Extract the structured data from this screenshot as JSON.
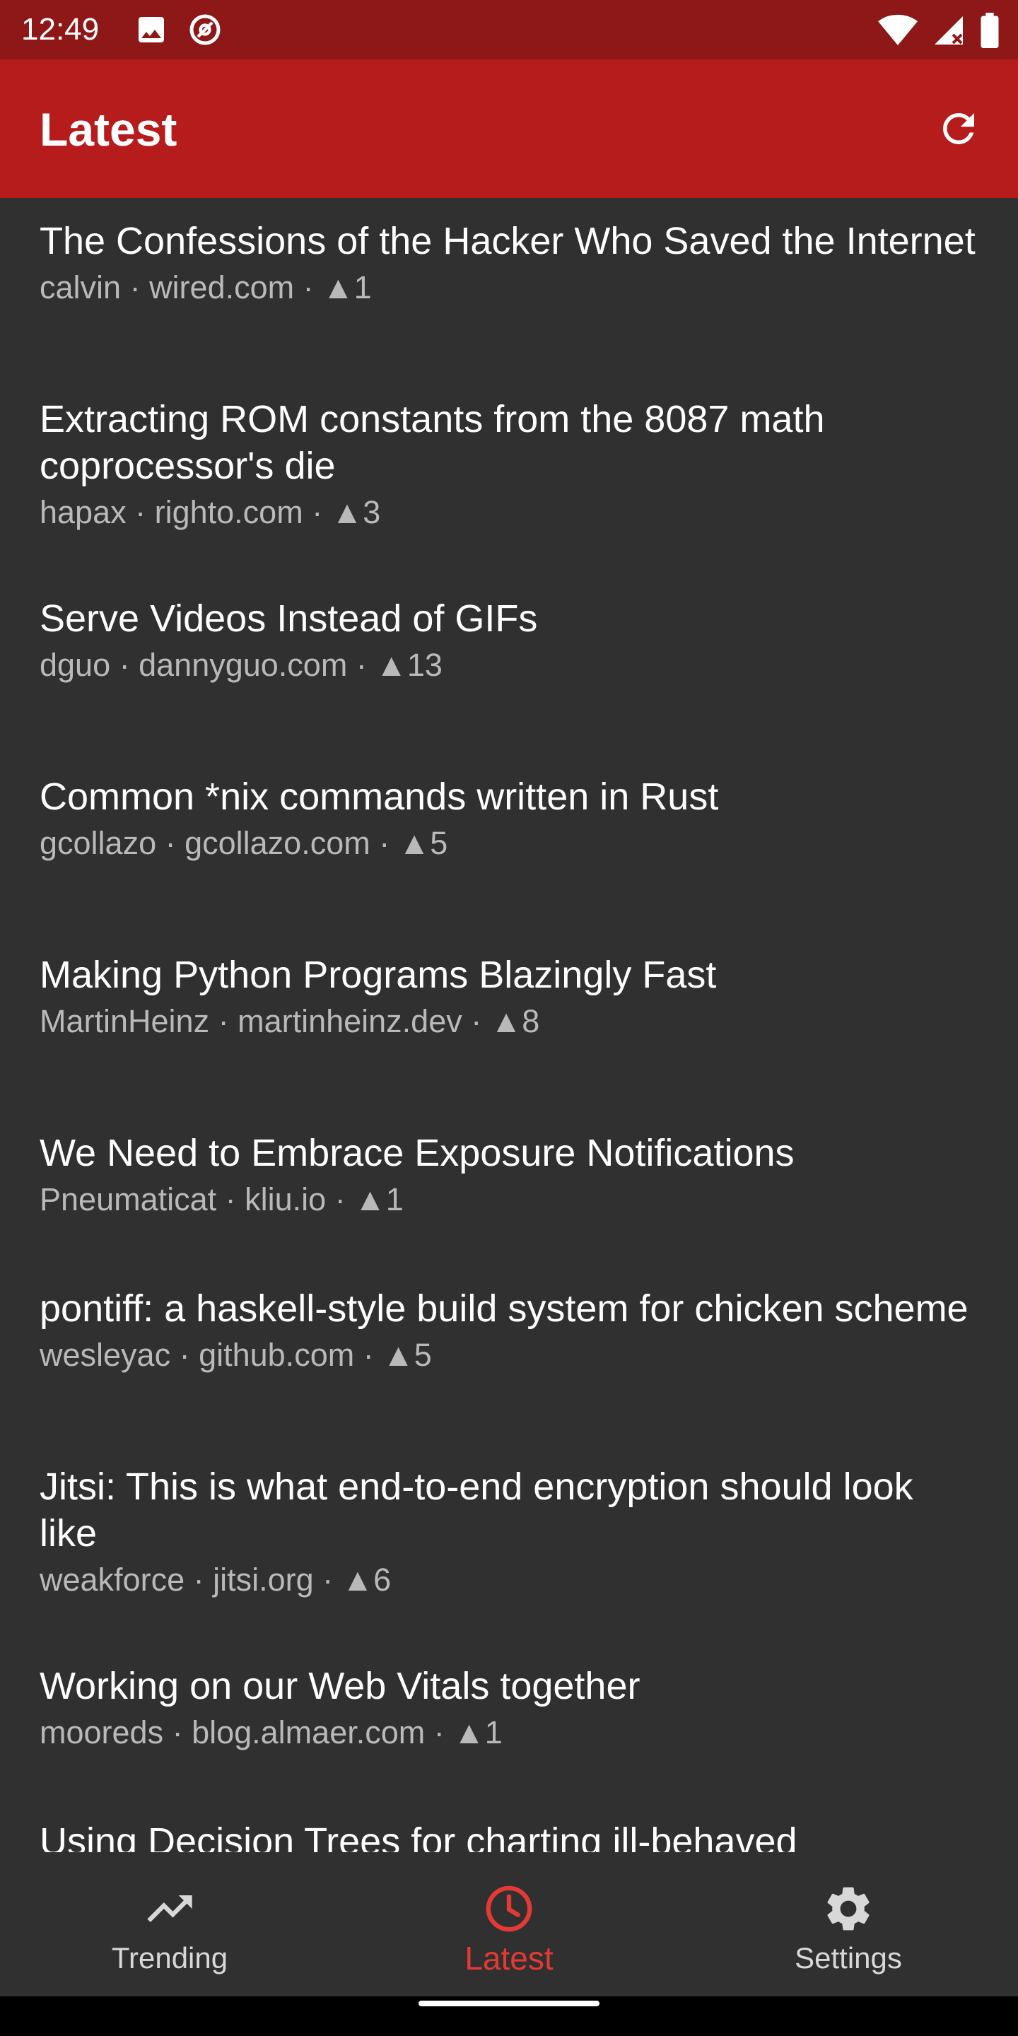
{
  "status_bar": {
    "time": "12:49",
    "left_icons": [
      "image-icon",
      "vpn-at-icon"
    ],
    "right_icons": [
      "wifi-icon",
      "signal-icon",
      "battery-icon"
    ]
  },
  "app_bar": {
    "title": "Latest",
    "action_icon": "refresh-icon",
    "color": "#b71c1c"
  },
  "stories": [
    {
      "title": "The Confessions of the Hacker Who Saved the Internet",
      "author": "calvin",
      "domain": "wired.com",
      "votes": "▲1"
    },
    {
      "title": "Extracting ROM constants from the 8087 math coprocessor's die",
      "author": "hapax",
      "domain": "righto.com",
      "votes": "▲3"
    },
    {
      "title": "Serve Videos Instead of GIFs",
      "author": "dguo",
      "domain": "dannyguo.com",
      "votes": "▲13"
    },
    {
      "title": "Common *nix commands written in Rust",
      "author": "gcollazo",
      "domain": "gcollazo.com",
      "votes": "▲5"
    },
    {
      "title": "Making Python Programs Blazingly Fast",
      "author": "MartinHeinz",
      "domain": "martinheinz.dev",
      "votes": "▲8"
    },
    {
      "title": "We Need to Embrace Exposure Notifications",
      "author": "Pneumaticat",
      "domain": "kliu.io",
      "votes": "▲1"
    },
    {
      "title": "pontiff: a haskell-style build system for chicken scheme",
      "author": "wesleyac",
      "domain": "github.com",
      "votes": "▲5"
    },
    {
      "title": "Jitsi: This is what end-to-end encryption should look like",
      "author": "weakforce",
      "domain": "jitsi.org",
      "votes": "▲6"
    },
    {
      "title": "Working on our Web Vitals together",
      "author": "mooreds",
      "domain": "blog.almaer.com",
      "votes": "▲1"
    },
    {
      "title": "Using Decision Trees for charting ill-behaved",
      "author": "",
      "domain": "",
      "votes": ""
    }
  ],
  "meta_separator": " · ",
  "bottom_nav": {
    "items": [
      {
        "label": "Trending",
        "icon": "trending-up-icon",
        "active": false
      },
      {
        "label": "Latest",
        "icon": "clock-icon",
        "active": true
      },
      {
        "label": "Settings",
        "icon": "gear-icon",
        "active": false
      }
    ],
    "active_color": "#e53935",
    "inactive_color": "#d8d8d8"
  }
}
